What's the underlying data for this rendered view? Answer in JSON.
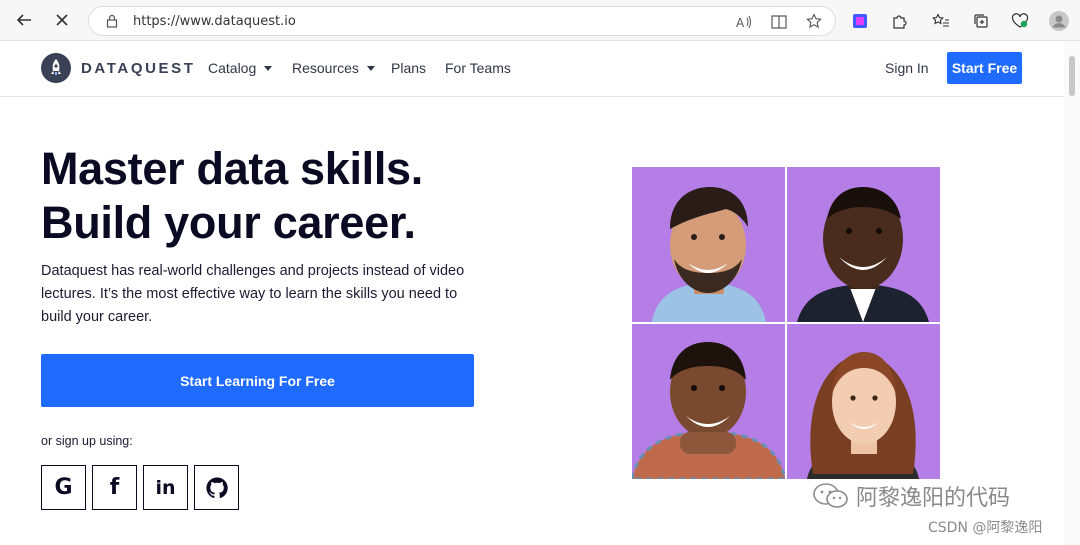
{
  "browser": {
    "url": "https://www.dataquest.io"
  },
  "header": {
    "logo_text": "DATAQUEST",
    "menu": [
      {
        "label": "Catalog",
        "dropdown": true
      },
      {
        "label": "Resources",
        "dropdown": true
      },
      {
        "label": "Plans",
        "dropdown": false
      },
      {
        "label": "For Teams",
        "dropdown": false
      }
    ],
    "signin_label": "Sign In",
    "start_free_label": "Start Free"
  },
  "hero": {
    "headline_line1": "Master data skills.",
    "headline_line2": "Build your career.",
    "subtext": "Dataquest has real-world challenges and projects instead of video lectures. It’s the most effective way to learn the skills you need to build your career.",
    "cta_label": "Start Learning For Free",
    "signup_label": "or sign up using:",
    "social_buttons": [
      {
        "name": "google",
        "glyph": "G"
      },
      {
        "name": "facebook",
        "glyph": "f"
      },
      {
        "name": "linkedin",
        "glyph": "in"
      },
      {
        "name": "github",
        "glyph": "github-icon"
      }
    ]
  },
  "watermark": {
    "main": "阿黎逸阳的代码",
    "sub": "CSDN @阿黎逸阳"
  },
  "colors": {
    "accent": "#1f6bff",
    "photo_bg": "#b47ee6",
    "text": "#0a0a23"
  }
}
